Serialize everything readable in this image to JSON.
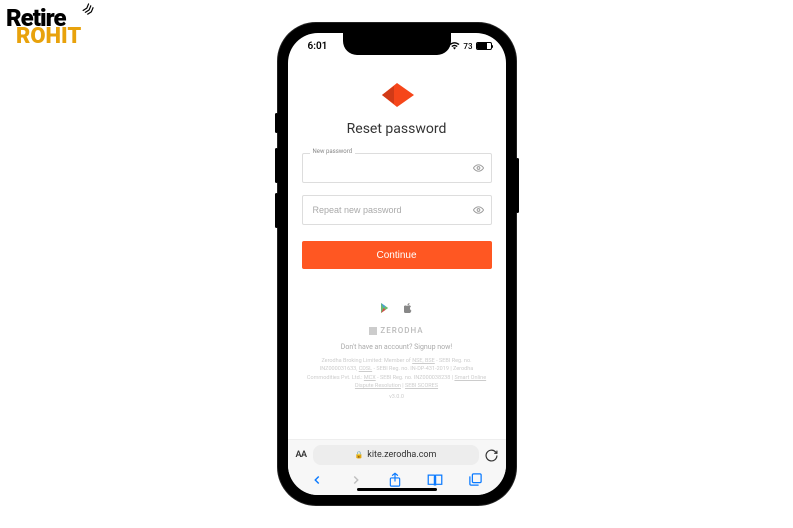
{
  "watermark": {
    "line1": "Retire",
    "line2": "ROHIT"
  },
  "statusbar": {
    "time": "6:01",
    "battery_pct": "73"
  },
  "page": {
    "title": "Reset password",
    "field1_label": "New password",
    "field2_placeholder": "Repeat new password",
    "continue_label": "Continue"
  },
  "brand": {
    "name": "ZERODHA",
    "signup_prefix": "Don't have an account? ",
    "signup_link": "Signup now!"
  },
  "legal": {
    "line1_a": "Zerodha Broking Limited: Member of ",
    "nse": "NSE, BSE",
    "line1_b": " ‐ SEBI Reg. no. INZ000031633, ",
    "cdsl": "CDSL",
    "line1_c": " ‐ SEBI Reg. no. IN-DP-431-2019 | Zerodha Commodities Pvt. Ltd.: ",
    "mcx": "MCX",
    "line1_d": " ‐ SEBI Reg. no. INZ000038238 | ",
    "smart": "Smart Online Dispute Resolution",
    "sep": " | ",
    "scores": "SEBI SCORES"
  },
  "version": "v3.0.0",
  "browser": {
    "aa": "AA",
    "domain": "kite.zerodha.com"
  }
}
